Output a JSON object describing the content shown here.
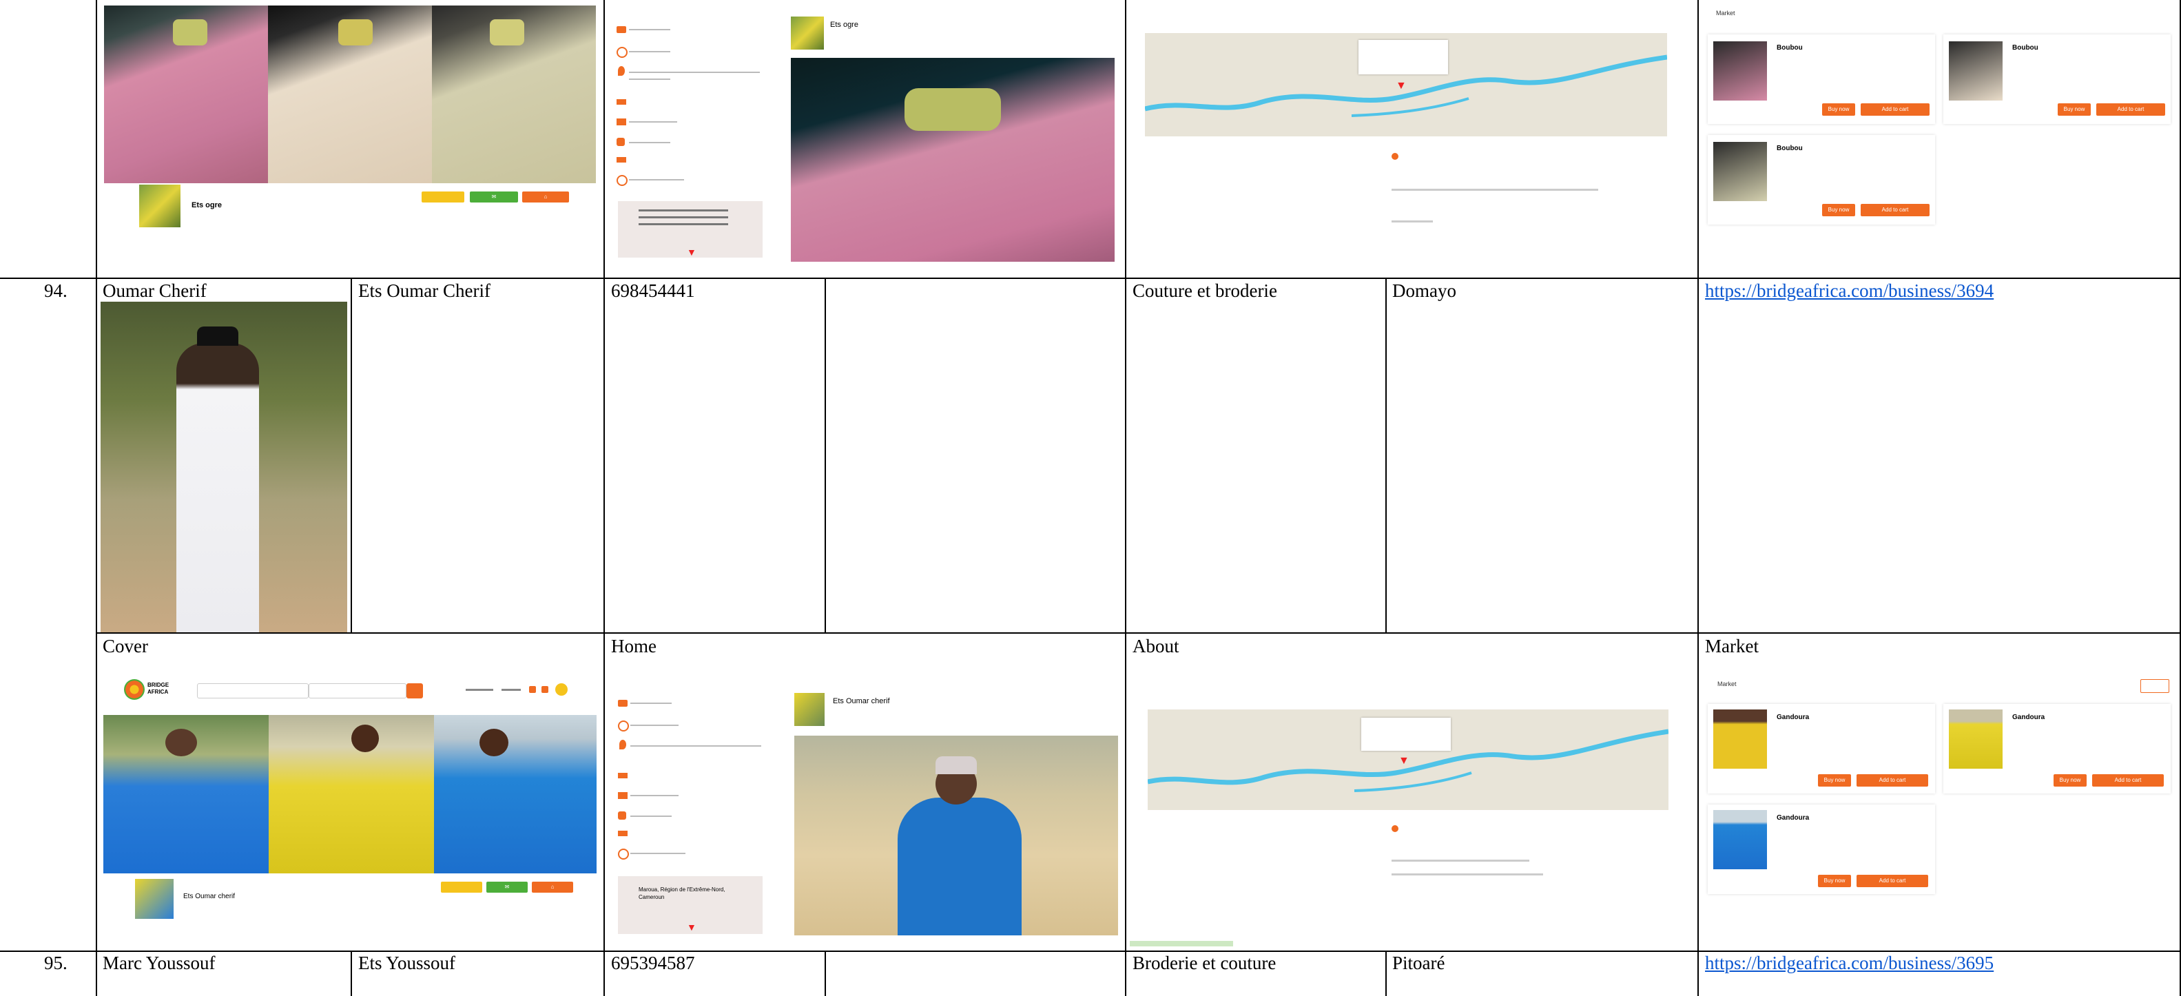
{
  "row94": {
    "number": "94.",
    "name": "Oumar Cherif",
    "business": "Ets Oumar Cherif",
    "phone": "698454441",
    "category": "Couture et broderie",
    "location": "Domayo",
    "url": "https://bridgeafrica.com/business/3694",
    "labels": {
      "cover": "Cover",
      "home": "Home",
      "about": "About",
      "market": "Market"
    }
  },
  "row95": {
    "number": "95.",
    "name": "Marc Youssouf",
    "business": "Ets Youssouf",
    "phone": "695394587",
    "category": "Broderie et couture",
    "location": "Pitoaré",
    "url": "https://bridgeafrica.com/business/3695"
  },
  "top_shots": {
    "cover_profile_name": "Ets ogre",
    "home_profile_name": "Ets ogre",
    "market_title": "Market",
    "market_items": [
      "Boubou",
      "Boubou",
      "Boubou"
    ],
    "market_btn_buy": "Buy now",
    "market_btn_cart": "Add to cart"
  },
  "bottom_shots": {
    "brand": "BRIDGE AFRICA",
    "cover_profile_name": "Ets Oumar cherif",
    "home_profile_name": "Ets Oumar cherif",
    "home_address": "Maroua, Région de l'Extrême-Nord, Cameroun",
    "market_title": "Market",
    "market_items": [
      "Gandoura",
      "Gandoura",
      "Gandoura"
    ],
    "market_btn_buy": "Buy now",
    "market_btn_cart": "Add to cart"
  },
  "colors": {
    "accent_orange": "#f06a21",
    "accent_green": "#4cae3a",
    "accent_yellow": "#f5c31c",
    "link_blue": "#0b57d0",
    "river_blue": "#4fc3e8"
  }
}
